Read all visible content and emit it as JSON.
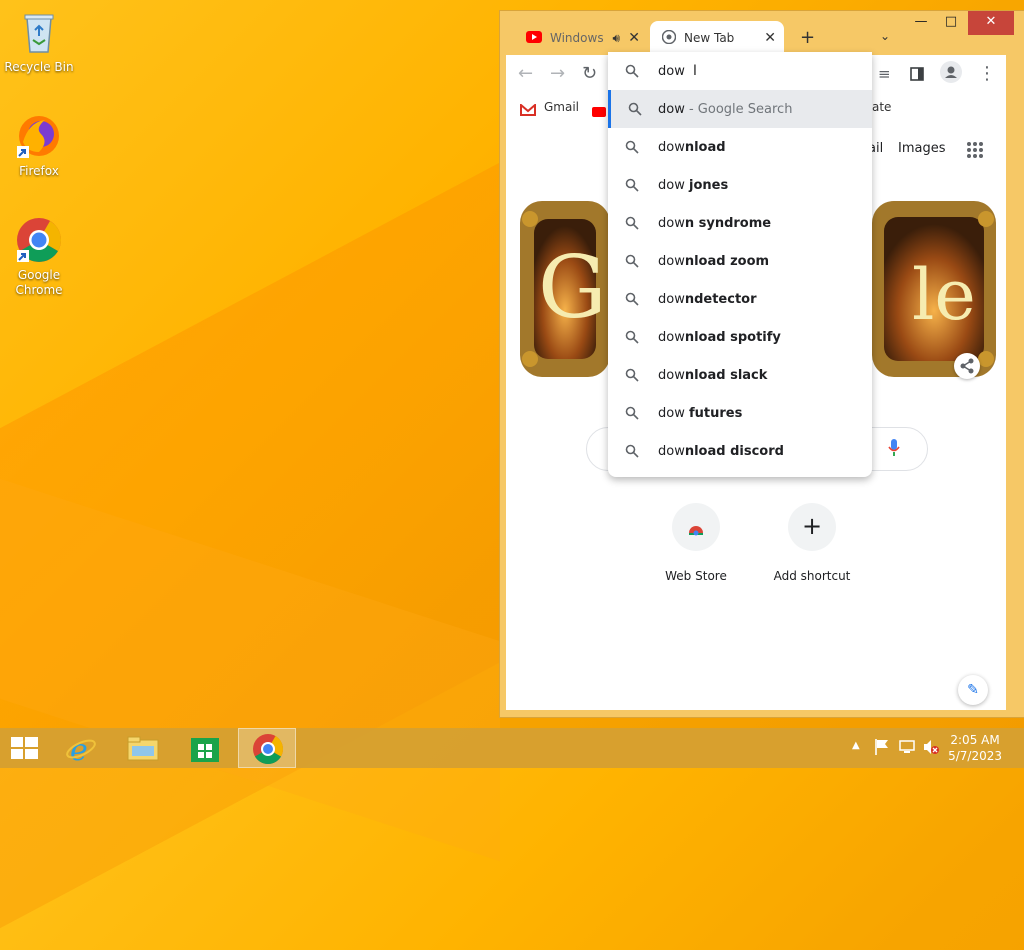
{
  "desktop": {
    "icons": [
      {
        "label": "Recycle Bin"
      },
      {
        "label": "Firefox"
      },
      {
        "label": "Google\nChrome"
      }
    ]
  },
  "browser": {
    "tabs": [
      {
        "title": "Windows",
        "icon": "youtube-icon",
        "active": false
      },
      {
        "title": "New Tab",
        "icon": "chrome-icon",
        "active": true
      }
    ],
    "bookmarks": [
      {
        "label": "Gmail"
      },
      {
        "label": "ate"
      }
    ],
    "omnibox": {
      "query": "dow",
      "suggestions": [
        {
          "prefix": "dow",
          "rest": " - Google Search",
          "kind": "search",
          "selected": true
        },
        {
          "prefix": "dow",
          "rest": "nload"
        },
        {
          "prefix": "dow ",
          "rest": "jones"
        },
        {
          "prefix": "dow",
          "rest": "n syndrome"
        },
        {
          "prefix": "dow",
          "rest": "nload zoom"
        },
        {
          "prefix": "dow",
          "rest": "ndetector"
        },
        {
          "prefix": "dow",
          "rest": "nload spotify"
        },
        {
          "prefix": "dow",
          "rest": "nload slack"
        },
        {
          "prefix": "dow ",
          "rest": "futures"
        },
        {
          "prefix": "dow",
          "rest": "nload discord"
        }
      ]
    },
    "ntp": {
      "top_links": {
        "gmail_partial": "ail",
        "images": "Images"
      },
      "shortcuts": [
        {
          "label": "Web Store"
        },
        {
          "label": "Add shortcut"
        }
      ]
    }
  },
  "taskbar": {
    "clock": {
      "time": "2:05 AM",
      "date": "5/7/2023"
    }
  },
  "colors": {
    "accent_blue": "#1a73e8",
    "close_red": "#c7453a",
    "desktop": "#ffb300"
  }
}
